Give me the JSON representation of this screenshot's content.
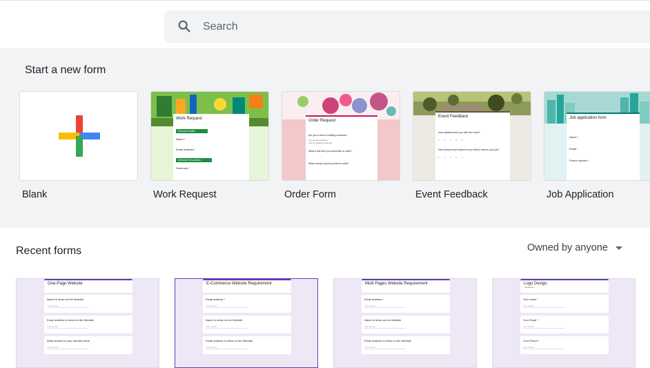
{
  "search": {
    "placeholder": "Search"
  },
  "start_section": {
    "title": "Start a new form",
    "templates": [
      {
        "label": "Blank"
      },
      {
        "label": "Work Request",
        "header": "Work Request",
        "section1": "Personal details",
        "field1": "Name *",
        "field2": "Email address *",
        "section2": "Describe the problem",
        "field3": "Summary *"
      },
      {
        "label": "Order Form",
        "header": "Order Request",
        "q1": "Are you a new or existing customer?",
        "o1": "I am a new customer",
        "o2": "I am an existing customer",
        "q2": "What is the item you would like to order?",
        "q3": "What color(s) would you like to order?"
      },
      {
        "label": "Event Feedback",
        "header": "Event Feedback",
        "q1": "How satisfied were you with the event?",
        "q2": "How relevant and helpful do you think it was for your job?"
      },
      {
        "label": "Job Application",
        "header": "Job application form",
        "field1": "Name *",
        "field2": "Email *",
        "field3": "Phone number *"
      }
    ]
  },
  "recent": {
    "title": "Recent forms",
    "owner_filter": "Owned by anyone",
    "docs": [
      {
        "title": "One-Page Website",
        "items": [
          "Name to show on the Website",
          "Email address to show on the Website",
          "What should be your domain name"
        ],
        "answer": "Your answer"
      },
      {
        "title": "E-Commerce Website Requirement",
        "items": [
          "Email address *",
          "Name to show on the Website",
          "Email address to show on the Website"
        ],
        "answer": "Your answer"
      },
      {
        "title": "Multi Pages Website Requirement",
        "items": [
          "Email address *",
          "Name to show on the Website",
          "Email address to show on the Website"
        ],
        "answer": "Your answer"
      },
      {
        "title": "Logo Design",
        "required": "* Required",
        "items": [
          "Your name *",
          "Your Email *",
          "Your Phone *"
        ],
        "answer": "Your answer"
      }
    ]
  },
  "colors": {
    "accent": "#673ab7",
    "plus_red": "#ea4335",
    "plus_blue": "#4285f4",
    "plus_yellow": "#fbbc04",
    "plus_green": "#34a853"
  }
}
